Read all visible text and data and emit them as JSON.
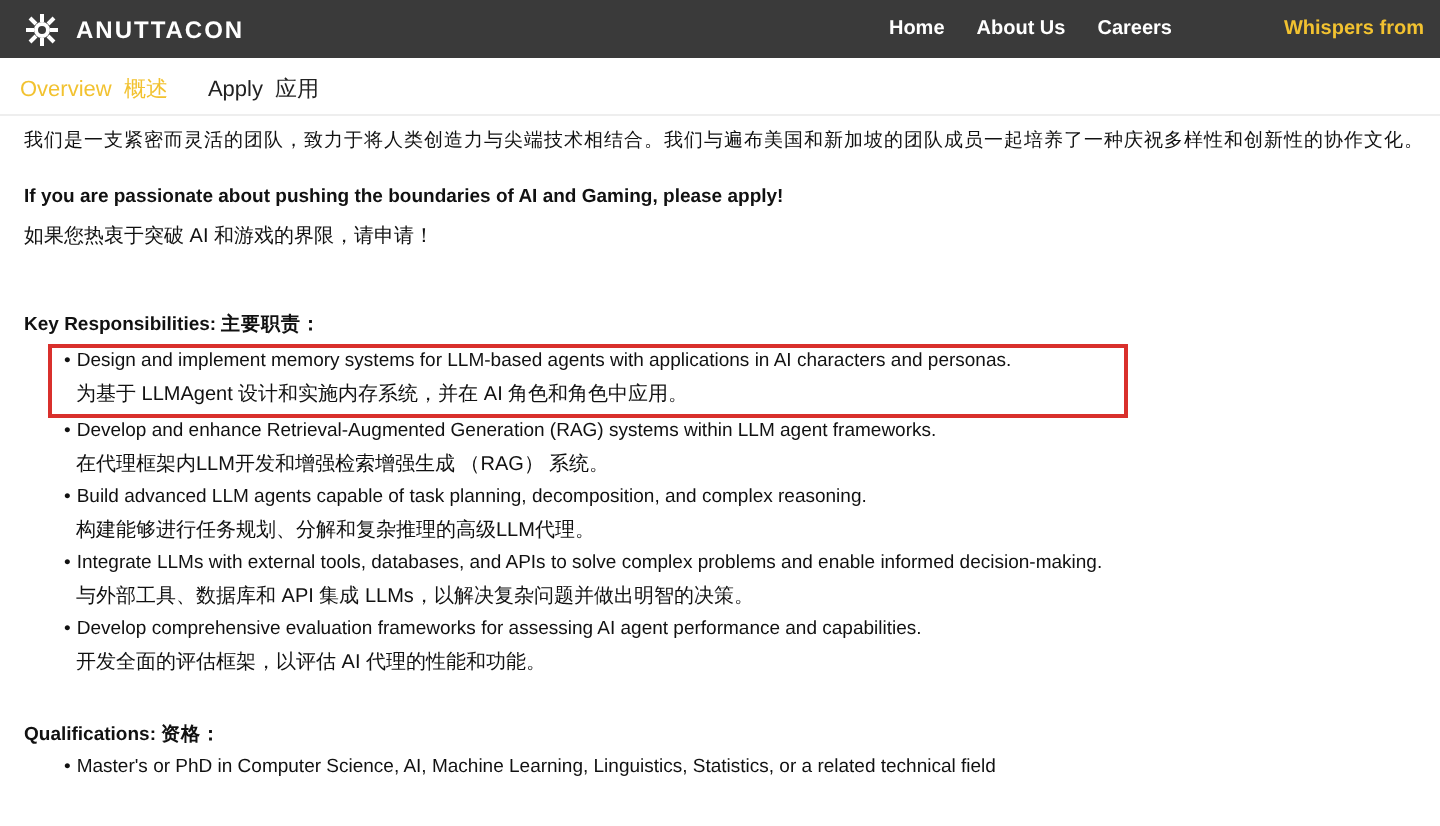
{
  "header": {
    "logo": "ANUTTACON",
    "nav": [
      {
        "label": "Home",
        "highlight": false
      },
      {
        "label": "About Us",
        "highlight": false
      },
      {
        "label": "Careers",
        "highlight": false
      },
      {
        "label": "Whispers from",
        "highlight": true
      }
    ]
  },
  "tabs": [
    {
      "label": "Overview  概述",
      "selected": true
    },
    {
      "label": "Apply  应用",
      "selected": false
    }
  ],
  "intro": [
    "我们是一支紧密而灵活的团队，致力于将人类创造力与尖端技术相结合。我们与遍布美国和新加坡的团队成员一起培养了一种庆祝多样性和创新性的协作文化。"
  ],
  "call_to_action": {
    "en": "If you are passionate about pushing the boundaries of AI and Gaming, please apply!",
    "zh": "如果您热衷于突破 AI 和游戏的界限，请申请！"
  },
  "responsibilities": {
    "heading": "Key Responsibilities:  主要职责：",
    "items": [
      {
        "bullet": "•",
        "en": "Design and implement memory systems for LLM-based agents with applications in AI characters and personas.",
        "zh": "为基于 LLMAgent 设计和实施内存系统，并在 AI 角色和角色中应用。",
        "highlighted": true
      },
      {
        "bullet": "•",
        "en": "Develop and enhance Retrieval-Augmented Generation (RAG) systems within LLM agent frameworks.",
        "zh": "在代理框架内LLM开发和增强检索增强生成 （RAG） 系统。",
        "highlighted": false
      },
      {
        "bullet": "•",
        "en": "Build advanced LLM agents capable of task planning, decomposition, and complex reasoning.",
        "zh": "构建能够进行任务规划、分解和复杂推理的高级LLM代理。",
        "highlighted": false
      },
      {
        "bullet": "•",
        "en": "Integrate LLMs with external tools, databases, and APIs to solve complex problems and enable informed decision-making.",
        "zh": "与外部工具、数据库和 API 集成 LLMs，以解决复杂问题并做出明智的决策。",
        "highlighted": false
      },
      {
        "bullet": "•",
        "en": "Develop comprehensive evaluation frameworks for assessing AI agent performance and capabilities.",
        "zh": "开发全面的评估框架，以评估 AI 代理的性能和功能。",
        "highlighted": false
      }
    ]
  },
  "qualifications": {
    "heading": "Qualifications:  资格：",
    "items": [
      {
        "bullet": "•",
        "en": "Master's or PhD in Computer Science, AI, Machine Learning, Linguistics, Statistics, or a related technical field"
      }
    ]
  }
}
